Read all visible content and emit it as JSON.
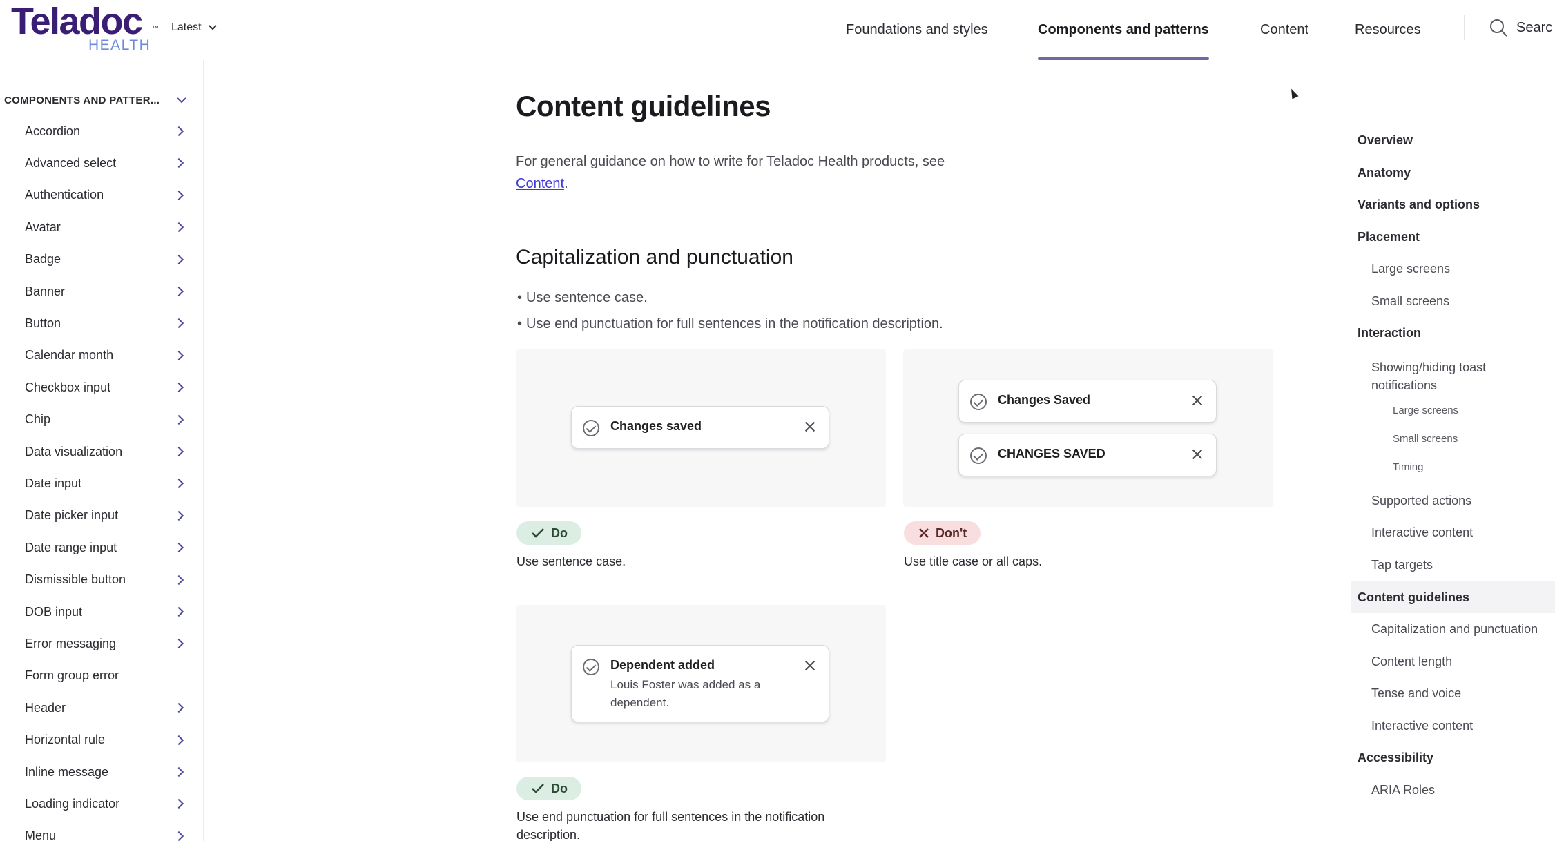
{
  "header": {
    "logo_main": "Teladoc",
    "logo_tm": "™",
    "logo_sub": "HEALTH",
    "version": "Latest",
    "nav": [
      {
        "label": "Foundations and styles",
        "active": false
      },
      {
        "label": "Components and patterns",
        "active": true
      },
      {
        "label": "Content",
        "active": false
      },
      {
        "label": "Resources",
        "active": false
      }
    ],
    "search_label": "Search",
    "search_visible_label": "Searc"
  },
  "sidebar": {
    "section_label": "COMPONENTS AND PATTER...",
    "items": [
      {
        "label": "Accordion",
        "has_children": true
      },
      {
        "label": "Advanced select",
        "has_children": true
      },
      {
        "label": "Authentication",
        "has_children": true
      },
      {
        "label": "Avatar",
        "has_children": true
      },
      {
        "label": "Badge",
        "has_children": true
      },
      {
        "label": "Banner",
        "has_children": true
      },
      {
        "label": "Button",
        "has_children": true
      },
      {
        "label": "Calendar month",
        "has_children": true
      },
      {
        "label": "Checkbox input",
        "has_children": true
      },
      {
        "label": "Chip",
        "has_children": true
      },
      {
        "label": "Data visualization",
        "has_children": true
      },
      {
        "label": "Date input",
        "has_children": true
      },
      {
        "label": "Date picker input",
        "has_children": true
      },
      {
        "label": "Date range input",
        "has_children": true
      },
      {
        "label": "Dismissible button",
        "has_children": true
      },
      {
        "label": "DOB input",
        "has_children": true
      },
      {
        "label": "Error messaging",
        "has_children": true
      },
      {
        "label": "Form group error",
        "has_children": false
      },
      {
        "label": "Header",
        "has_children": true
      },
      {
        "label": "Horizontal rule",
        "has_children": true
      },
      {
        "label": "Inline message",
        "has_children": true
      },
      {
        "label": "Loading indicator",
        "has_children": true
      },
      {
        "label": "Menu",
        "has_children": true
      }
    ]
  },
  "main": {
    "title": "Content guidelines",
    "intro_text": "For general guidance on how to write for Teladoc Health products, see",
    "intro_link": "Content",
    "intro_end": ".",
    "section_title": "Capitalization and punctuation",
    "bullets": [
      "Use sentence case.",
      "Use end punctuation for full sentences in the notification description."
    ],
    "examples": {
      "do_case": {
        "toast_title": "Changes saved",
        "badge": "Do",
        "caption": "Use sentence case."
      },
      "dont_case": {
        "toast_title_1": "Changes Saved",
        "toast_title_2": "CHANGES SAVED",
        "badge": "Don't",
        "caption": "Use title case or all caps."
      },
      "do_punct": {
        "toast_title": "Dependent added",
        "toast_desc": "Louis Foster was added as a dependent.",
        "badge": "Do",
        "caption": "Use end punctuation for full sentences in the notification description."
      }
    }
  },
  "toc": [
    {
      "label": "Overview",
      "level": 1
    },
    {
      "label": "Anatomy",
      "level": 1
    },
    {
      "label": "Variants and options",
      "level": 1
    },
    {
      "label": "Placement",
      "level": 1
    },
    {
      "label": "Large screens",
      "level": 2
    },
    {
      "label": "Small screens",
      "level": 2
    },
    {
      "label": "Interaction",
      "level": 1
    },
    {
      "label": "Showing/hiding toast notifications",
      "level": 2
    },
    {
      "label": "Large screens",
      "level": 3
    },
    {
      "label": "Small screens",
      "level": 3
    },
    {
      "label": "Timing",
      "level": 3
    },
    {
      "label": "Supported actions",
      "level": 2
    },
    {
      "label": "Interactive content",
      "level": 2
    },
    {
      "label": "Tap targets",
      "level": 2
    },
    {
      "label": "Content guidelines",
      "level": 1,
      "active": true
    },
    {
      "label": "Capitalization and punctuation",
      "level": 2
    },
    {
      "label": "Content length",
      "level": 2
    },
    {
      "label": "Tense and voice",
      "level": 2
    },
    {
      "label": "Interactive content",
      "level": 2
    },
    {
      "label": "Accessibility",
      "level": 1
    },
    {
      "label": "ARIA Roles",
      "level": 2
    }
  ],
  "colors": {
    "brand": "#3a1d74",
    "brand_sub": "#6b8bd8",
    "link": "#3d3ad6",
    "do_bg": "#dceee3",
    "dont_bg": "#f8dede"
  }
}
